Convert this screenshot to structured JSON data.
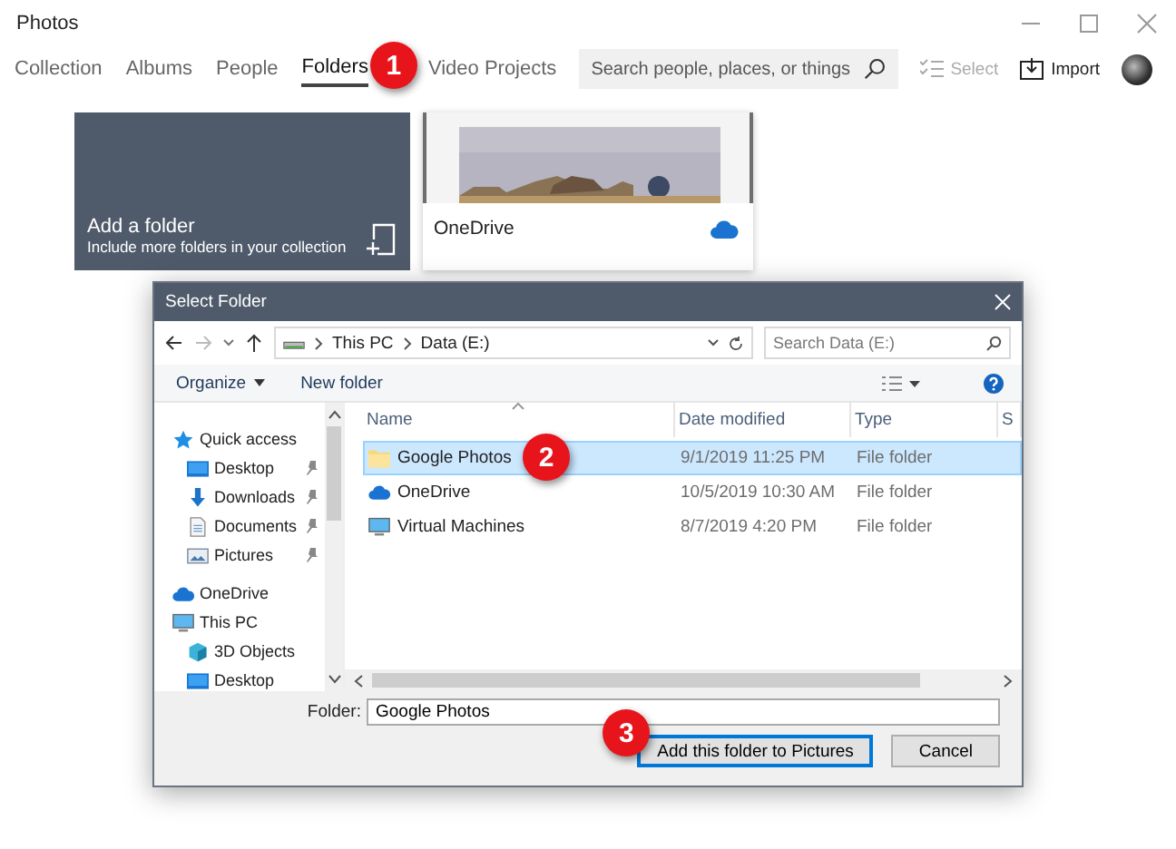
{
  "window": {
    "title": "Photos"
  },
  "tabs": [
    {
      "label": "Collection",
      "selected": false
    },
    {
      "label": "Albums",
      "selected": false
    },
    {
      "label": "People",
      "selected": false
    },
    {
      "label": "Folders",
      "selected": true,
      "badge": "1"
    },
    {
      "label": "Video Projects",
      "selected": false
    }
  ],
  "search": {
    "placeholder": "Search people, places, or things"
  },
  "toolbar": [
    {
      "kind": "select",
      "label": "Select",
      "disabled": true
    },
    {
      "kind": "import",
      "label": "Import",
      "disabled": false
    }
  ],
  "cards": [
    {
      "kind": "add",
      "title": "Add a folder",
      "subtitle": "Include more folders in your collection"
    },
    {
      "kind": "cloud",
      "title": "OneDrive"
    }
  ],
  "dialog": {
    "title": "Select Folder",
    "address": [
      "This PC",
      "Data (E:)"
    ],
    "search_placeholder": "Search Data (E:)",
    "commands": [
      "Organize",
      "New folder"
    ],
    "nav": [
      {
        "label": "Quick access",
        "kind": "star",
        "pinned": false,
        "children": [
          {
            "label": "Desktop",
            "kind": "desktop",
            "pinned": true
          },
          {
            "label": "Downloads",
            "kind": "download",
            "pinned": true
          },
          {
            "label": "Documents",
            "kind": "document",
            "pinned": true
          },
          {
            "label": "Pictures",
            "kind": "pictures",
            "pinned": true
          }
        ]
      },
      {
        "label": "OneDrive",
        "kind": "cloud",
        "pinned": false
      },
      {
        "label": "This PC",
        "kind": "pc",
        "pinned": false,
        "children": [
          {
            "label": "3D Objects",
            "kind": "cube",
            "pinned": false
          },
          {
            "label": "Desktop",
            "kind": "desktop",
            "pinned": false
          }
        ]
      }
    ],
    "columns": [
      "Name",
      "Date modified",
      "Type",
      "S"
    ],
    "files": [
      {
        "name": "Google Photos",
        "kind": "folder",
        "date": "9/1/2019 11:25 PM",
        "type": "File folder",
        "selected": true,
        "badge": "2"
      },
      {
        "name": "OneDrive",
        "kind": "cloud",
        "date": "10/5/2019 10:30 AM",
        "type": "File folder",
        "selected": false
      },
      {
        "name": "Virtual Machines",
        "kind": "pc",
        "date": "8/7/2019 4:20 PM",
        "type": "File folder",
        "selected": false
      }
    ],
    "folder_label": "Folder:",
    "folder_value": "Google Photos",
    "buttons": [
      {
        "label": "Add this folder to Pictures",
        "default": true,
        "badge": "3"
      },
      {
        "label": "Cancel",
        "default": false
      }
    ]
  }
}
